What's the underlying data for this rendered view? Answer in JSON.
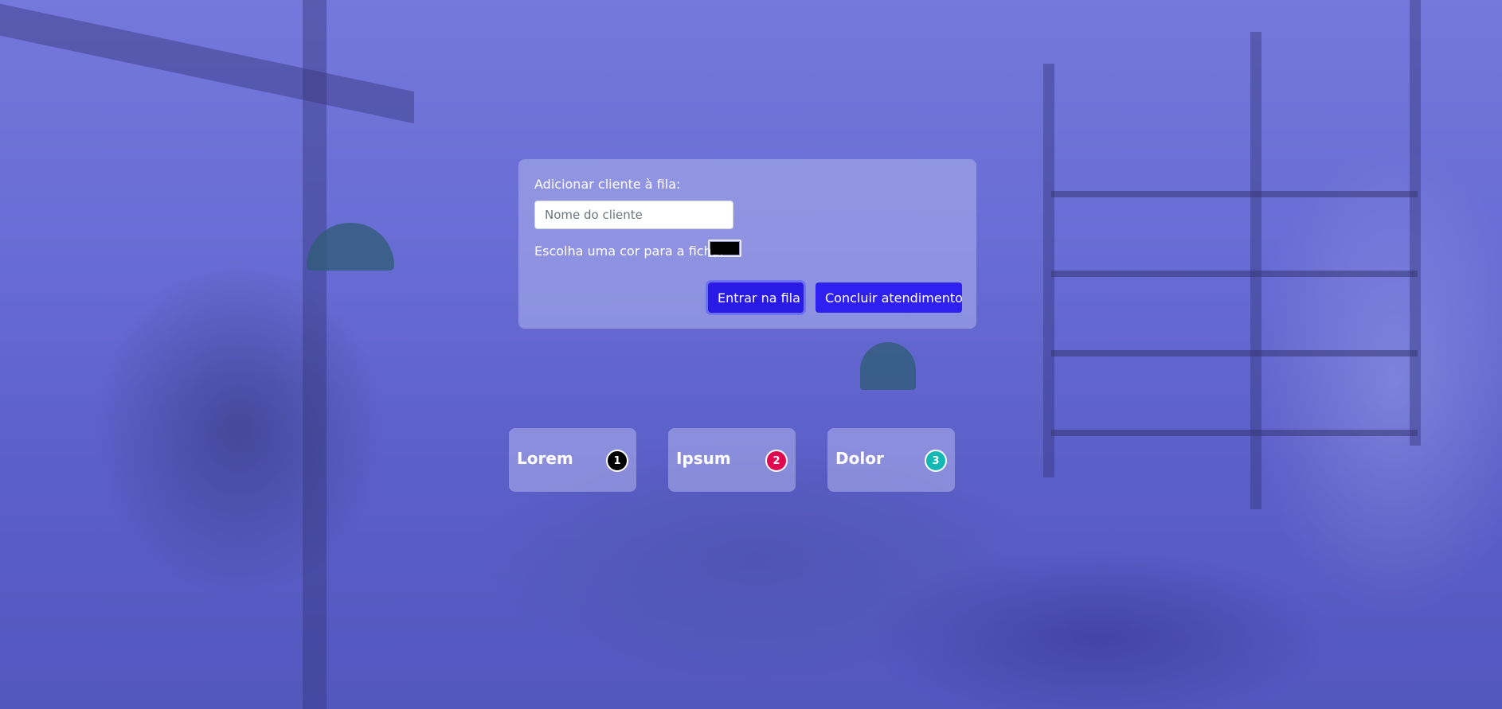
{
  "form": {
    "label": "Adicionar cliente à fila:",
    "name_value": "",
    "name_placeholder": "Nome do cliente",
    "color_label": "Escolha uma cor para a ficha:",
    "color_value": "#000000",
    "join_button": "Entrar na fila",
    "finish_button": "Concluir atendimento"
  },
  "queue": [
    {
      "name": "Lorem",
      "number": "1",
      "color": "#000000"
    },
    {
      "name": "Ipsum",
      "number": "2",
      "color": "#e0094f"
    },
    {
      "name": "Dolor",
      "number": "3",
      "color": "#12b8b4"
    }
  ],
  "colors": {
    "button": "#2f1ff0",
    "tint": "#5a5fc4"
  }
}
